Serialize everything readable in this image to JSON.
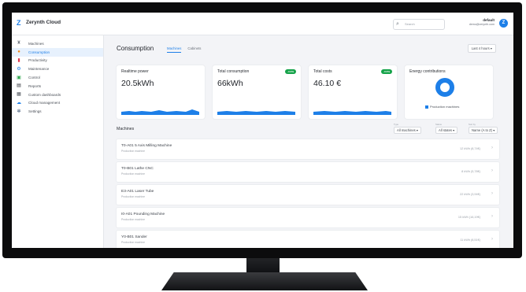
{
  "app": {
    "title": "Zerynth Cloud"
  },
  "search": {
    "placeholder": "Search"
  },
  "user": {
    "name": "default",
    "email": "demo@zerynth.com",
    "initial": "Z"
  },
  "sidebar": {
    "items": [
      {
        "label": "Machines",
        "icon": "machine-icon",
        "active": false
      },
      {
        "label": "Consumption",
        "icon": "consumption-icon",
        "active": true
      },
      {
        "label": "Productivity",
        "icon": "productivity-icon",
        "active": false
      },
      {
        "label": "Maintenance",
        "icon": "maintenance-icon",
        "active": false
      },
      {
        "label": "Control",
        "icon": "control-icon",
        "active": false
      },
      {
        "label": "Reports",
        "icon": "reports-icon",
        "active": false
      },
      {
        "label": "Custom dashboards",
        "icon": "dashboard-icon",
        "active": false
      },
      {
        "label": "Cloud management",
        "icon": "cloud-icon",
        "active": false
      },
      {
        "label": "Settings",
        "icon": "gear-icon",
        "active": false
      }
    ]
  },
  "header": {
    "title": "Consumption",
    "tabs": [
      {
        "label": "Machines",
        "active": true
      },
      {
        "label": "Cabinets",
        "active": false
      }
    ],
    "time_range": "Last 4 hours ▾"
  },
  "cards": {
    "power": {
      "label": "Realtime power",
      "value": "20.5kWh"
    },
    "consumption": {
      "label": "Total consumption",
      "value": "66kWh",
      "badge": "-0.0%"
    },
    "costs": {
      "label": "Total costs",
      "value": "46.10 €",
      "badge": "-0.0%"
    },
    "energy": {
      "label": "Energy contributions",
      "legend": "Production machines"
    }
  },
  "filters": {
    "type": {
      "label": "Type",
      "value": "All machines ▾"
    },
    "status": {
      "label": "Status",
      "value": "All states ▾"
    },
    "sort": {
      "label": "Sort by",
      "value": "Name (A to Z) ▾"
    }
  },
  "machines": {
    "title": "Machines",
    "rows": [
      {
        "name": "T0-A01 5 Axis Milling Machine",
        "type": "Production machine",
        "energy": "12 kWh (8,74€)"
      },
      {
        "name": "T0-B01 Lathe CNC",
        "type": "Production machine",
        "energy": "8 kWh (5,78€)"
      },
      {
        "name": "E3-A01 Laser Tube",
        "type": "Production machine",
        "energy": "22 kWh (3,94€)"
      },
      {
        "name": "I0-A01 Pounding Machine",
        "type": "Production machine",
        "energy": "15 kWh (16,19€)"
      },
      {
        "name": "Y0-B01 Sander",
        "type": "Production machine",
        "energy": "11 kWh (8,51€)"
      }
    ]
  },
  "colors": {
    "accent": "#1d7fe8",
    "badge": "#16a34a"
  }
}
